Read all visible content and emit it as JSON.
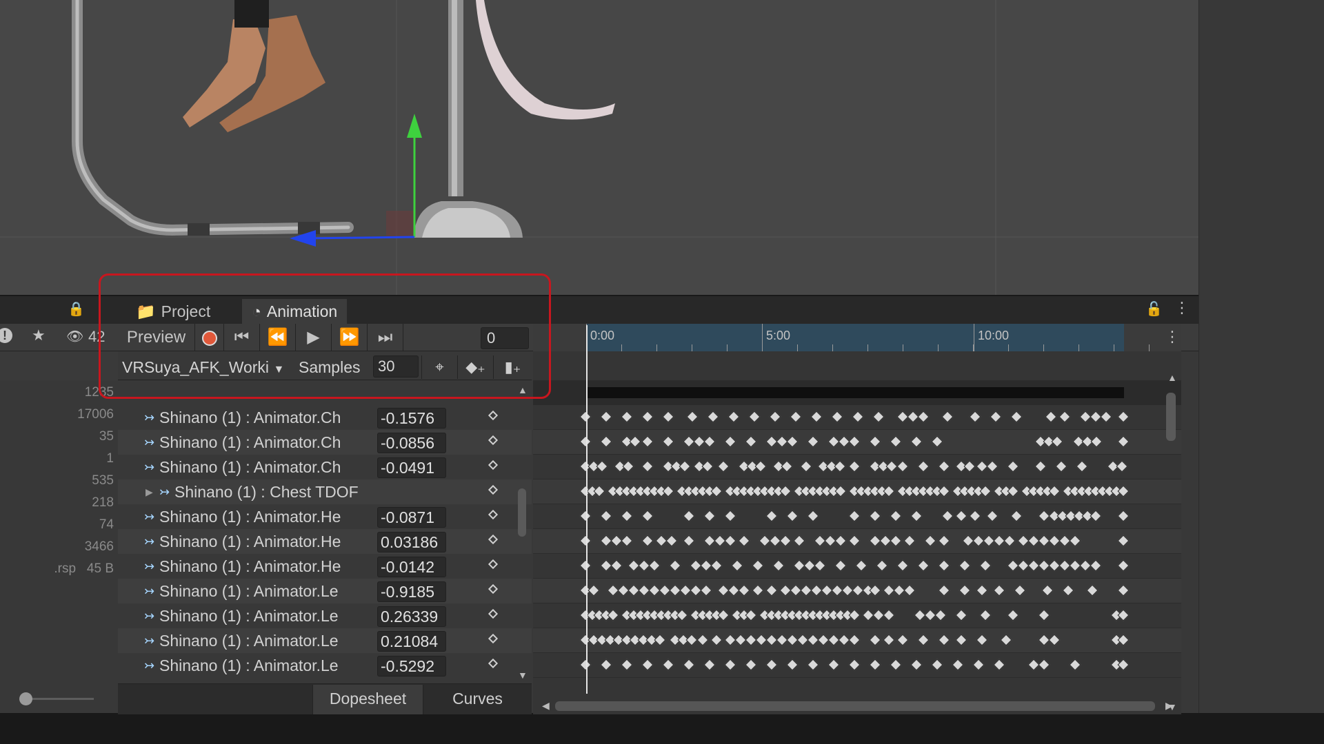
{
  "project_panel": {
    "hidden_count": "42",
    "counts": [
      "1235",
      "17006",
      "35",
      "1",
      "535",
      "218",
      "74",
      "3466"
    ],
    "rsp_label": ".rsp",
    "rsp_size": "45 B"
  },
  "tabs": [
    {
      "label": "Project",
      "icon": "folder-icon"
    },
    {
      "label": "Animation",
      "icon": "clock-icon"
    }
  ],
  "toolbar": {
    "preview_label": "Preview",
    "frame_value": "0"
  },
  "clip": {
    "name": "VRSuya_AFK_Worki",
    "samples_label": "Samples",
    "samples_value": "30"
  },
  "properties": [
    {
      "name": "Shinano (1) : Animator.Ch",
      "value": "-0.1576"
    },
    {
      "name": "Shinano (1) : Animator.Ch",
      "value": "-0.0856"
    },
    {
      "name": "Shinano (1) : Animator.Ch",
      "value": "-0.0491"
    },
    {
      "name": "Shinano (1) : Chest TDOF",
      "value": ""
    },
    {
      "name": "Shinano (1) : Animator.He",
      "value": "-0.0871"
    },
    {
      "name": "Shinano (1) : Animator.He",
      "value": "0.03186"
    },
    {
      "name": "Shinano (1) : Animator.He",
      "value": "-0.0142"
    },
    {
      "name": "Shinano (1) : Animator.Le",
      "value": "-0.9185"
    },
    {
      "name": "Shinano (1) : Animator.Le",
      "value": "0.26339"
    },
    {
      "name": "Shinano (1) : Animator.Le",
      "value": "0.21084"
    },
    {
      "name": "Shinano (1) : Animator.Le",
      "value": "-0.5292"
    }
  ],
  "bottom_tabs": {
    "dopesheet": "Dopesheet",
    "curves": "Curves"
  },
  "timeline": {
    "ticks": [
      "0:00",
      "5:00",
      "10:00"
    ]
  },
  "colors": {
    "record": "#e0583a",
    "highlight": "#c8161e",
    "gizmo_y": "#3ed13e",
    "gizmo_z": "#2244ee"
  }
}
